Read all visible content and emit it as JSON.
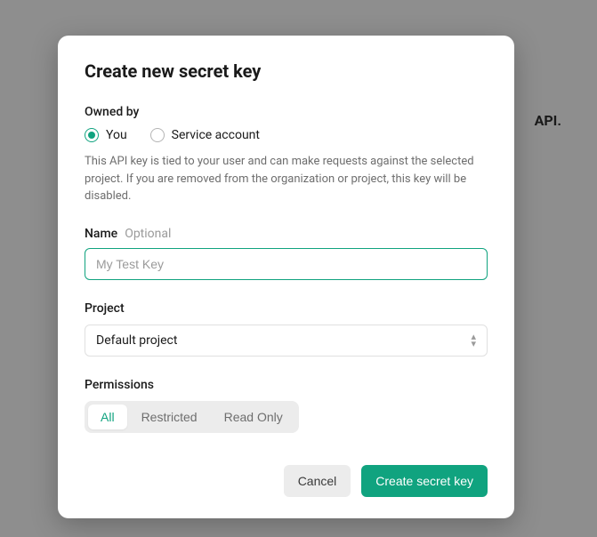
{
  "background": {
    "partial_text": "API."
  },
  "modal": {
    "title": "Create new secret key",
    "owned_by": {
      "label": "Owned by",
      "options": {
        "you": "You",
        "service_account": "Service account"
      },
      "selected": "you",
      "description": "This API key is tied to your user and can make requests against the selected project. If you are removed from the organization or project, this key will be disabled."
    },
    "name_field": {
      "label": "Name",
      "hint": "Optional",
      "placeholder": "My Test Key",
      "value": ""
    },
    "project_field": {
      "label": "Project",
      "selected": "Default project"
    },
    "permissions": {
      "label": "Permissions",
      "options": {
        "all": "All",
        "restricted": "Restricted",
        "read_only": "Read Only"
      },
      "selected": "all"
    },
    "buttons": {
      "cancel": "Cancel",
      "create": "Create secret key"
    }
  }
}
